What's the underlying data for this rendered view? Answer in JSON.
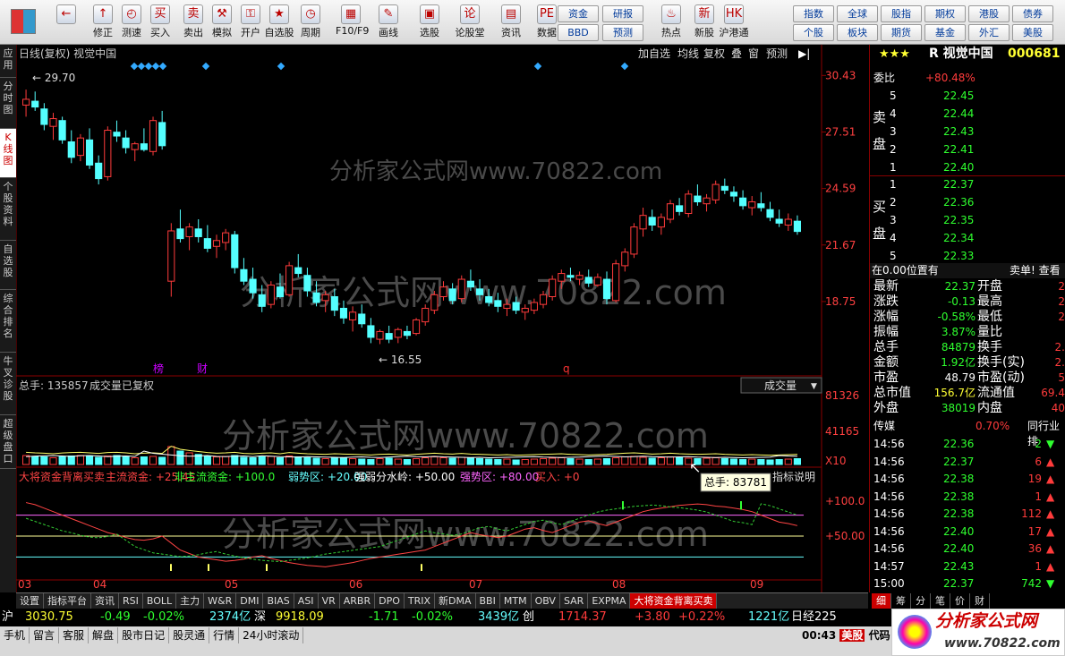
{
  "toolbar": {
    "main": [
      {
        "icon": "←",
        "label": ""
      },
      {
        "icon": "↑",
        "label": "修正"
      },
      {
        "icon": "◴",
        "label": "测速"
      },
      {
        "icon": "买",
        "label": "买入"
      },
      {
        "icon": "卖",
        "label": "卖出"
      },
      {
        "icon": "⚒",
        "label": "模拟"
      },
      {
        "icon": "⚿",
        "label": "开户"
      },
      {
        "icon": "★",
        "label": "自选股"
      },
      {
        "icon": "◷",
        "label": "周期"
      },
      {
        "icon": "▦",
        "label": "F10/F9"
      },
      {
        "icon": "✎",
        "label": "画线"
      },
      {
        "icon": "▣",
        "label": "选股"
      },
      {
        "icon": "论",
        "label": "论股堂"
      },
      {
        "icon": "▤",
        "label": "资讯"
      },
      {
        "icon": "PE",
        "label": "数据"
      },
      {
        "icon": "♨",
        "label": "热点"
      },
      {
        "icon": "新",
        "label": "新股"
      },
      {
        "icon": "HK",
        "label": "沪港通"
      }
    ],
    "mid_buttons": [
      "资金",
      "研报",
      "BBD",
      "预测"
    ],
    "right_buttons": [
      "指数",
      "全球",
      "股指",
      "期权",
      "港股",
      "债券",
      "个股",
      "板块",
      "期货",
      "基金",
      "外汇",
      "美股"
    ]
  },
  "left_tabs": [
    "应用",
    "分时图",
    "K线图",
    "个股资料",
    "自选股",
    "综合排名",
    "牛叉诊股",
    "超级盘口"
  ],
  "chart": {
    "title": "日线(复权) 视觉中国",
    "header_buttons": [
      "加自选",
      "均线",
      "复权",
      "叠",
      "窗",
      "预测"
    ],
    "price_ticks": [
      "30.43",
      "27.51",
      "24.59",
      "21.67",
      "18.75"
    ],
    "high_label": "29.70",
    "low_label": "16.55",
    "volume_title": "总手: 135857",
    "volume_sub": "成交量已复权",
    "volume_dropdown": "成交量",
    "volume_ticks": [
      "81326",
      "41165",
      "X10"
    ],
    "tooltip": "总手: 83781",
    "indicator_title": "大将资金背离买卖",
    "indicator_values": [
      {
        "t": "主流资金: +25.45",
        "c": "#ff4444"
      },
      {
        "t": "非主流资金: +100.0",
        "c": "#33ff33"
      },
      {
        "t": "弱势区: +20.00",
        "c": "#66ffff"
      },
      {
        "t": "强弱分水岭: +50.00",
        "c": "#ffffff"
      },
      {
        "t": "强势区: +80.00",
        "c": "#ff66ff"
      },
      {
        "t": "买入: +0",
        "c": "#ff4444"
      }
    ],
    "indicator_help": "指标说明",
    "indicator_ticks": [
      "+100.0",
      "+50.00"
    ],
    "months": [
      "03",
      "04",
      "05",
      "06",
      "07",
      "08",
      "09"
    ],
    "markers": [
      "榜",
      "财",
      "q"
    ],
    "watermark": "分析家公式网www.70822.com",
    "chart_data": {
      "type": "candlestick",
      "ylim": [
        15,
        31
      ],
      "candles": [
        [
          28.9,
          29.7,
          28.3,
          29.2
        ],
        [
          29.1,
          29.6,
          28.6,
          28.8
        ],
        [
          28.7,
          29.0,
          27.6,
          27.9
        ],
        [
          27.8,
          28.5,
          27.1,
          28.2
        ],
        [
          28.1,
          28.3,
          26.9,
          27.1
        ],
        [
          27.0,
          27.6,
          25.9,
          26.2
        ],
        [
          26.3,
          27.4,
          26.0,
          27.2
        ],
        [
          27.1,
          27.7,
          25.6,
          25.8
        ],
        [
          25.9,
          26.3,
          24.8,
          25.1
        ],
        [
          25.2,
          27.8,
          25.0,
          27.6
        ],
        [
          27.5,
          28.1,
          27.0,
          27.3
        ],
        [
          27.2,
          27.6,
          26.4,
          26.7
        ],
        [
          26.6,
          27.0,
          26.0,
          26.9
        ],
        [
          26.9,
          27.7,
          26.5,
          26.6
        ],
        [
          26.5,
          28.3,
          26.3,
          28.1
        ],
        [
          28.0,
          28.6,
          26.6,
          26.8
        ],
        [
          19.8,
          22.8,
          19.0,
          22.4
        ],
        [
          22.5,
          23.5,
          21.8,
          22.0
        ],
        [
          22.1,
          22.8,
          21.4,
          22.6
        ],
        [
          22.5,
          23.0,
          21.8,
          22.1
        ],
        [
          22.0,
          22.7,
          21.3,
          21.5
        ],
        [
          21.6,
          22.2,
          21.0,
          21.9
        ],
        [
          21.8,
          22.5,
          21.4,
          22.3
        ],
        [
          22.2,
          22.4,
          20.2,
          20.5
        ],
        [
          20.4,
          21.0,
          19.6,
          19.8
        ],
        [
          19.9,
          20.5,
          18.9,
          19.2
        ],
        [
          19.1,
          19.6,
          18.2,
          18.5
        ],
        [
          18.6,
          19.8,
          18.4,
          19.6
        ],
        [
          19.5,
          20.2,
          18.9,
          19.0
        ],
        [
          19.1,
          20.8,
          19.0,
          20.6
        ],
        [
          20.5,
          21.2,
          20.0,
          20.2
        ],
        [
          20.1,
          20.5,
          19.0,
          19.3
        ],
        [
          19.2,
          19.8,
          18.5,
          18.7
        ],
        [
          18.8,
          19.3,
          18.2,
          19.1
        ],
        [
          19.0,
          19.4,
          18.0,
          18.3
        ],
        [
          18.4,
          18.8,
          17.6,
          17.9
        ],
        [
          17.8,
          18.5,
          17.2,
          18.2
        ],
        [
          18.1,
          18.6,
          17.4,
          17.6
        ],
        [
          17.5,
          17.9,
          16.6,
          16.9
        ],
        [
          16.8,
          17.3,
          16.55,
          17.2
        ],
        [
          17.1,
          17.5,
          16.6,
          16.8
        ],
        [
          16.9,
          17.4,
          16.6,
          17.3
        ],
        [
          17.2,
          17.5,
          16.8,
          17.0
        ],
        [
          17.1,
          17.9,
          17.0,
          17.8
        ],
        [
          17.7,
          18.6,
          17.5,
          18.4
        ],
        [
          18.3,
          19.3,
          18.1,
          19.1
        ],
        [
          19.0,
          19.8,
          18.8,
          19.5
        ],
        [
          19.4,
          19.7,
          18.6,
          18.8
        ],
        [
          18.9,
          20.1,
          18.7,
          19.9
        ],
        [
          19.8,
          20.4,
          19.3,
          19.5
        ],
        [
          19.4,
          19.9,
          18.8,
          19.1
        ],
        [
          19.0,
          19.4,
          18.5,
          18.7
        ],
        [
          18.8,
          19.2,
          18.2,
          18.5
        ],
        [
          18.4,
          18.9,
          18.0,
          18.6
        ],
        [
          18.7,
          19.0,
          18.1,
          18.3
        ],
        [
          18.2,
          18.6,
          17.8,
          18.4
        ],
        [
          18.3,
          18.9,
          18.1,
          18.7
        ],
        [
          18.6,
          19.3,
          18.4,
          19.1
        ],
        [
          19.0,
          20.1,
          18.8,
          19.9
        ],
        [
          19.8,
          20.4,
          19.4,
          20.2
        ],
        [
          20.1,
          20.5,
          19.8,
          20.0
        ],
        [
          19.9,
          20.3,
          19.6,
          20.1
        ],
        [
          20.0,
          20.4,
          19.5,
          19.7
        ],
        [
          19.6,
          20.2,
          19.5,
          20.0
        ],
        [
          19.9,
          20.3,
          18.6,
          18.9
        ],
        [
          18.8,
          20.9,
          18.7,
          20.7
        ],
        [
          20.6,
          21.5,
          20.3,
          21.3
        ],
        [
          21.2,
          22.8,
          21.0,
          22.6
        ],
        [
          22.5,
          23.6,
          22.1,
          23.2
        ],
        [
          23.1,
          23.5,
          22.4,
          22.7
        ],
        [
          22.6,
          23.3,
          22.2,
          23.1
        ],
        [
          23.0,
          24.0,
          22.8,
          23.8
        ],
        [
          23.7,
          24.1,
          23.2,
          23.4
        ],
        [
          23.3,
          24.5,
          23.1,
          24.3
        ],
        [
          24.2,
          24.8,
          23.7,
          23.9
        ],
        [
          23.8,
          24.3,
          23.4,
          24.1
        ],
        [
          24.0,
          25.0,
          23.8,
          24.8
        ],
        [
          24.7,
          25.1,
          24.3,
          24.5
        ],
        [
          24.4,
          24.7,
          23.9,
          24.2
        ],
        [
          24.1,
          24.5,
          23.5,
          23.7
        ],
        [
          23.6,
          24.2,
          23.2,
          23.9
        ],
        [
          23.8,
          24.4,
          23.4,
          23.6
        ],
        [
          23.5,
          23.9,
          22.9,
          23.1
        ],
        [
          23.0,
          23.5,
          22.6,
          22.8
        ],
        [
          22.7,
          23.3,
          22.4,
          23.0
        ],
        [
          22.9,
          23.2,
          22.2,
          22.37
        ]
      ]
    }
  },
  "quote": {
    "stars": "★★★",
    "code": "000681",
    "name": "R 视觉中国",
    "weibi_label": "委比",
    "weibi": "+80.48%",
    "sell": [
      {
        "n": "5",
        "p": "22.45",
        "v": ""
      },
      {
        "n": "4",
        "p": "22.44",
        "v": ""
      },
      {
        "n": "3",
        "p": "22.43",
        "v": ""
      },
      {
        "n": "2",
        "p": "22.41",
        "v": ""
      },
      {
        "n": "1",
        "p": "22.40",
        "v": ""
      }
    ],
    "sell_label": "卖盘",
    "buy_label": "买盘",
    "buy": [
      {
        "n": "1",
        "p": "22.37",
        "v": ""
      },
      {
        "n": "2",
        "p": "22.36",
        "v": ""
      },
      {
        "n": "3",
        "p": "22.35",
        "v": ""
      },
      {
        "n": "4",
        "p": "22.34",
        "v": ""
      },
      {
        "n": "5",
        "p": "22.33",
        "v": ""
      }
    ],
    "pos_note": "在0.00位置有",
    "pos_note2": "卖单! 查看",
    "stats": [
      [
        "最新",
        "22.37",
        "开盘",
        "2"
      ],
      [
        "涨跌",
        "-0.13",
        "最高",
        "2"
      ],
      [
        "涨幅",
        "-0.58%",
        "最低",
        "2"
      ],
      [
        "振幅",
        "3.87%",
        "量比",
        ""
      ],
      [
        "总手",
        "84879",
        "换手",
        "2."
      ],
      [
        "金额",
        "1.92亿",
        "换手(实)",
        "2."
      ],
      [
        "市盈",
        "48.79",
        "市盈(动)",
        "5"
      ],
      [
        "总市值",
        "156.7亿",
        "流通值",
        "69.4"
      ],
      [
        "外盘",
        "38019",
        "内盘",
        "40"
      ]
    ],
    "sector": "传媒",
    "sector_pct": "0.70%",
    "sector_rank": "同行业排",
    "trades": [
      [
        "14:56",
        "22.36",
        "2",
        "down"
      ],
      [
        "14:56",
        "22.37",
        "6",
        "up"
      ],
      [
        "14:56",
        "22.38",
        "19",
        "up"
      ],
      [
        "14:56",
        "22.38",
        "1",
        "up"
      ],
      [
        "14:56",
        "22.38",
        "112",
        "up"
      ],
      [
        "14:56",
        "22.40",
        "17",
        "up"
      ],
      [
        "14:56",
        "22.40",
        "36",
        "up"
      ],
      [
        "14:57",
        "22.43",
        "1",
        "up"
      ],
      [
        "15:00",
        "22.37",
        "742",
        "down"
      ]
    ],
    "tabs": [
      "细",
      "筹",
      "分",
      "笔",
      "价",
      "财"
    ]
  },
  "bottom_tabs": [
    "设置",
    "指标平台",
    "资讯",
    "RSI",
    "BOLL",
    "主力",
    "W&R",
    "DMI",
    "BIAS",
    "ASI",
    "VR",
    "ARBR",
    "DPO",
    "TRIX",
    "新DMA",
    "BBI",
    "MTM",
    "OBV",
    "SAR",
    "EXPMA",
    "大将资金背离买卖"
  ],
  "ticker": [
    {
      "t": "沪",
      "c": "white"
    },
    {
      "t": "3030.75",
      "c": "yellow"
    },
    {
      "t": "-0.49",
      "c": "green"
    },
    {
      "t": "-0.02%",
      "c": "green"
    },
    {
      "t": "2374亿",
      "c": "cyan"
    },
    {
      "t": "深",
      "c": "white"
    },
    {
      "t": "9918.09",
      "c": "yellow"
    },
    {
      "t": "-1.71",
      "c": "green"
    },
    {
      "t": "-0.02%",
      "c": "green"
    },
    {
      "t": "3439亿",
      "c": "cyan"
    },
    {
      "t": "创",
      "c": "white"
    },
    {
      "t": "1714.37",
      "c": "red"
    },
    {
      "t": "+3.80",
      "c": "red"
    },
    {
      "t": "+0.22%",
      "c": "red"
    },
    {
      "t": "1221亿",
      "c": "cyan"
    },
    {
      "t": "日经225",
      "c": "white"
    }
  ],
  "status": {
    "items": [
      "手机",
      "留言",
      "客服",
      "解盘",
      "股市日记",
      "股灵通",
      "行情",
      "24小时滚动"
    ],
    "time": "00:43",
    "market": "美股",
    "extra": "代码"
  },
  "logo": {
    "name": "分析家公式网",
    "url": "www.70822.com"
  }
}
